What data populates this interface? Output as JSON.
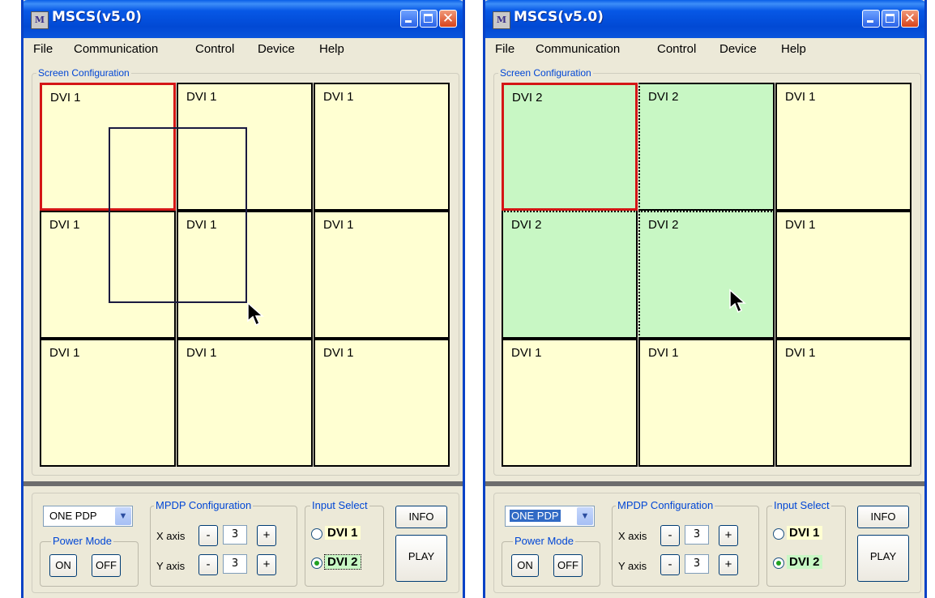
{
  "windows": [
    {
      "title": "MSCS(v5.0)",
      "app_icon_glyph": "M",
      "menu": [
        "File",
        "Communication",
        "Control",
        "Device",
        "Help"
      ],
      "screen_config_label": "Screen Configuration",
      "cells": [
        {
          "label": "DVI 1",
          "color": "#ffffd2",
          "selected": true
        },
        {
          "label": "DVI 1",
          "color": "#ffffd2",
          "selected": false
        },
        {
          "label": "DVI 1",
          "color": "#ffffd2",
          "selected": false
        },
        {
          "label": "DVI 1",
          "color": "#ffffd2",
          "selected": false
        },
        {
          "label": "DVI 1",
          "color": "#ffffd2",
          "selected": false
        },
        {
          "label": "DVI 1",
          "color": "#ffffd2",
          "selected": false
        },
        {
          "label": "DVI 1",
          "color": "#ffffd2",
          "selected": false
        },
        {
          "label": "DVI 1",
          "color": "#ffffd2",
          "selected": false
        },
        {
          "label": "DVI 1",
          "color": "#ffffd2",
          "selected": false
        }
      ],
      "mode_select": {
        "value": "ONE PDP",
        "highlighted": false
      },
      "power_mode": {
        "label": "Power Mode",
        "on_label": "ON",
        "off_label": "OFF"
      },
      "mpdp": {
        "label": "MPDP Configuration",
        "x_label": "X axis",
        "x_value": "3",
        "y_label": "Y axis",
        "y_value": "3",
        "minus": "-",
        "plus": "+"
      },
      "input_select": {
        "label": "Input Select",
        "dvi1_label": "DVI 1",
        "dvi2_label": "DVI 2",
        "selected": "DVI 2"
      },
      "info_label": "INFO",
      "play_label": "PLAY"
    },
    {
      "title": "MSCS(v5.0)",
      "app_icon_glyph": "M",
      "menu": [
        "File",
        "Communication",
        "Control",
        "Device",
        "Help"
      ],
      "screen_config_label": "Screen Configuration",
      "cells": [
        {
          "label": "DVI 2",
          "color": "#c8f7c4",
          "selected": true
        },
        {
          "label": "DVI 2",
          "color": "#c8f7c4",
          "selected": false
        },
        {
          "label": "DVI 1",
          "color": "#ffffd2",
          "selected": false
        },
        {
          "label": "DVI 2",
          "color": "#c8f7c4",
          "selected": false
        },
        {
          "label": "DVI 2",
          "color": "#c8f7c4",
          "selected": false
        },
        {
          "label": "DVI 1",
          "color": "#ffffd2",
          "selected": false
        },
        {
          "label": "DVI 1",
          "color": "#ffffd2",
          "selected": false
        },
        {
          "label": "DVI 1",
          "color": "#ffffd2",
          "selected": false
        },
        {
          "label": "DVI 1",
          "color": "#ffffd2",
          "selected": false
        }
      ],
      "mode_select": {
        "value": "ONE PDP",
        "highlighted": true
      },
      "power_mode": {
        "label": "Power Mode",
        "on_label": "ON",
        "off_label": "OFF"
      },
      "mpdp": {
        "label": "MPDP Configuration",
        "x_label": "X axis",
        "x_value": "3",
        "y_label": "Y axis",
        "y_value": "3",
        "minus": "-",
        "plus": "+"
      },
      "input_select": {
        "label": "Input Select",
        "dvi1_label": "DVI 1",
        "dvi2_label": "DVI 2",
        "selected": "DVI 2"
      },
      "info_label": "INFO",
      "play_label": "PLAY"
    }
  ],
  "colors": {
    "dvi1_cell": "#ffffd2",
    "dvi2_cell": "#c8f7c4",
    "selection_border": "#d41616",
    "titlebar_blue": "#0758e6",
    "close_red": "#d8431b"
  },
  "icons": [
    "app-logo-icon",
    "minimize-icon",
    "maximize-icon",
    "close-icon",
    "chevron-down-icon",
    "mouse-pointer-icon"
  ]
}
